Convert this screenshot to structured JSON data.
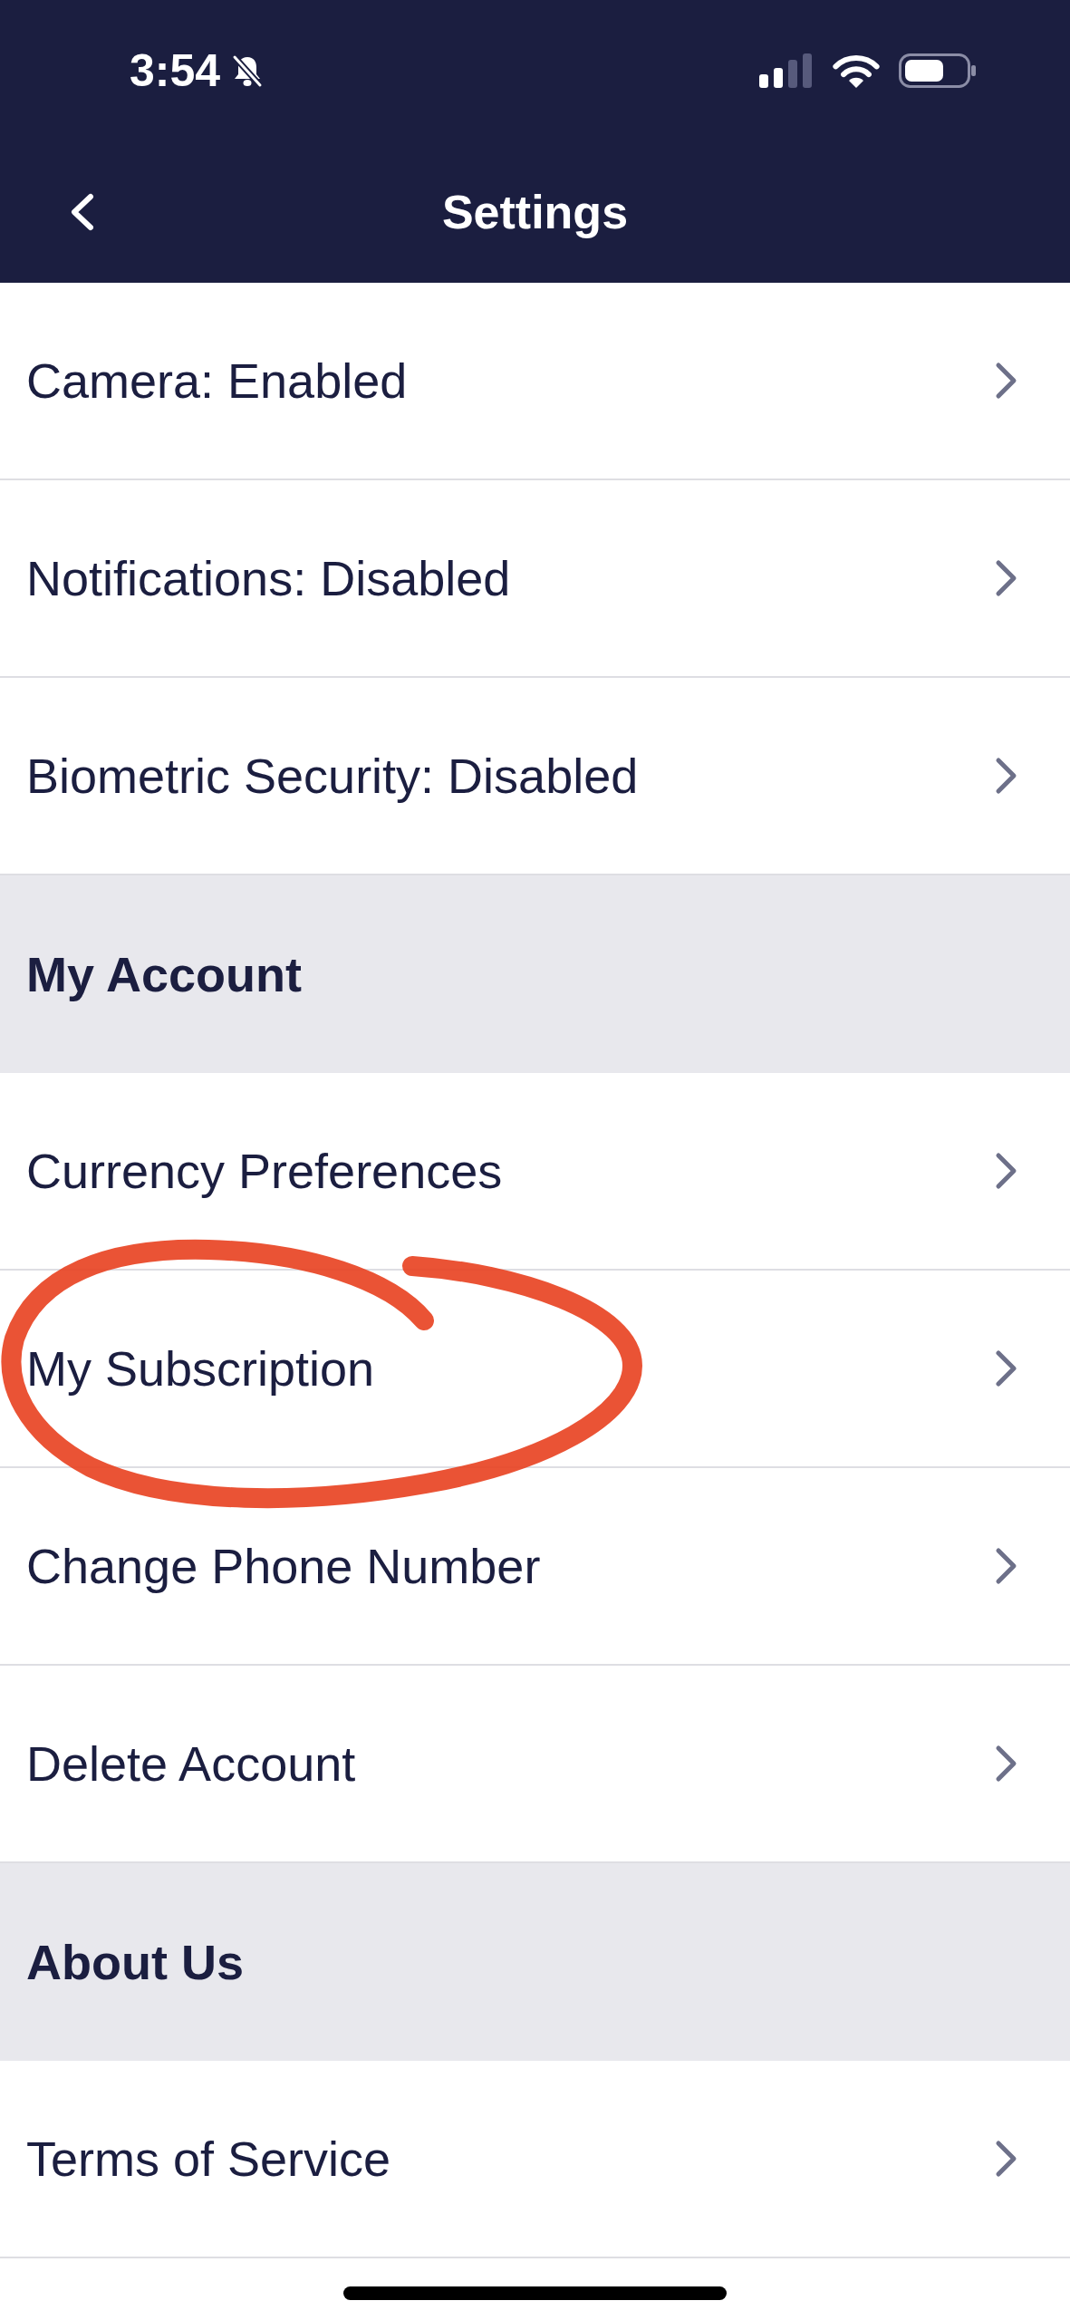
{
  "status_bar": {
    "time": "3:54",
    "silent": true
  },
  "nav_bar": {
    "title": "Settings"
  },
  "list": [
    {
      "kind": "row",
      "label": "Camera: Enabled",
      "circled": false
    },
    {
      "kind": "row",
      "label": "Notifications: Disabled",
      "circled": false
    },
    {
      "kind": "row",
      "label": "Biometric Security: Disabled",
      "circled": false
    },
    {
      "kind": "section",
      "label": "My Account",
      "circled": false
    },
    {
      "kind": "row",
      "label": "Currency Preferences",
      "circled": false
    },
    {
      "kind": "row",
      "label": "My Subscription",
      "circled": true
    },
    {
      "kind": "row",
      "label": "Change Phone Number",
      "circled": false
    },
    {
      "kind": "row",
      "label": "Delete Account",
      "circled": false
    },
    {
      "kind": "section",
      "label": "About Us",
      "circled": false
    },
    {
      "kind": "row",
      "label": "Terms of Service",
      "circled": false
    }
  ]
}
